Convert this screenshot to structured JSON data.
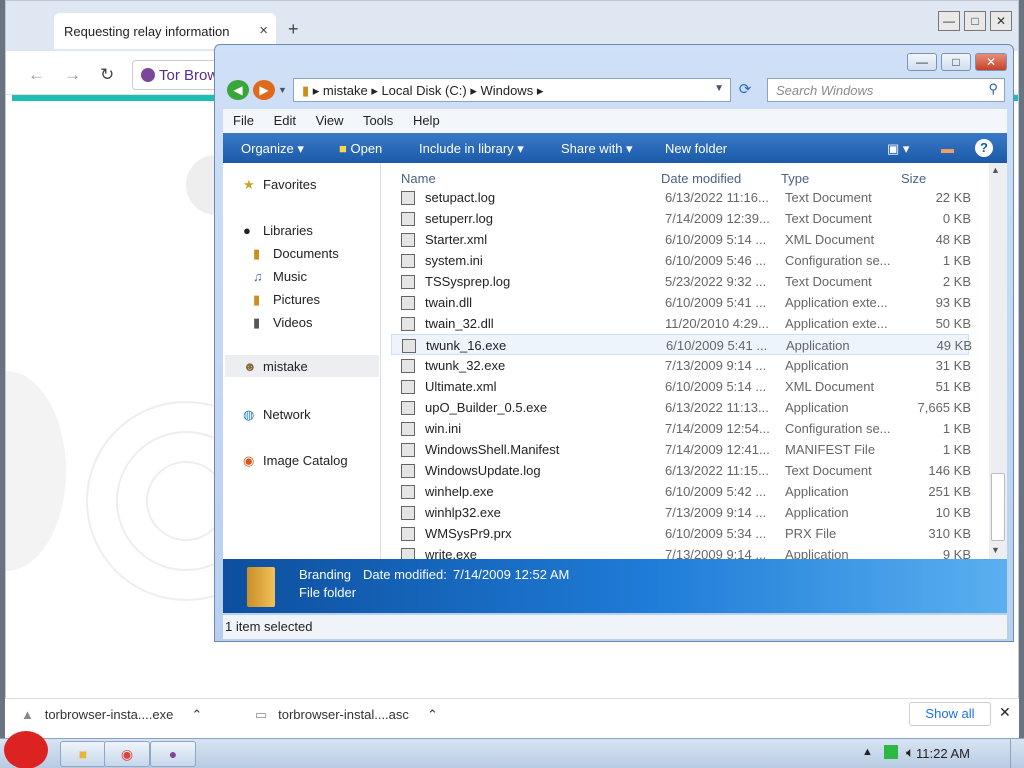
{
  "browser": {
    "tab_title": "Requesting relay information",
    "tab_close": "×",
    "new_tab": "+",
    "back": "←",
    "forward": "→",
    "reload": "↻",
    "omnibox_text": "Tor Brow",
    "win_min": "—",
    "win_max": "□",
    "win_close": "✕"
  },
  "explorer": {
    "breadcrumb": [
      "mistake",
      "Local Disk (C:)",
      "Windows"
    ],
    "search_placeholder": "Search Windows",
    "menu": [
      "File",
      "Edit",
      "View",
      "Tools",
      "Help"
    ],
    "commands": [
      "Organize",
      "Open",
      "Include in library",
      "Share with",
      "New folder"
    ],
    "nav": {
      "favorites": "Favorites",
      "libraries": "Libraries",
      "documents": "Documents",
      "music": "Music",
      "pictures": "Pictures",
      "videos": "Videos",
      "mistake": "mistake",
      "network": "Network",
      "image_catalog": "Image Catalog"
    },
    "columns": {
      "name": "Name",
      "date": "Date modified",
      "type": "Type",
      "size": "Size"
    },
    "files": [
      {
        "name": "setupact.log",
        "date": "6/13/2022 11:16...",
        "type": "Text Document",
        "size": "22 KB"
      },
      {
        "name": "setuperr.log",
        "date": "7/14/2009 12:39...",
        "type": "Text Document",
        "size": "0 KB"
      },
      {
        "name": "Starter.xml",
        "date": "6/10/2009 5:14 ...",
        "type": "XML Document",
        "size": "48 KB"
      },
      {
        "name": "system.ini",
        "date": "6/10/2009 5:46 ...",
        "type": "Configuration se...",
        "size": "1 KB"
      },
      {
        "name": "TSSysprep.log",
        "date": "5/23/2022 9:32 ...",
        "type": "Text Document",
        "size": "2 KB"
      },
      {
        "name": "twain.dll",
        "date": "6/10/2009 5:41 ...",
        "type": "Application exte...",
        "size": "93 KB"
      },
      {
        "name": "twain_32.dll",
        "date": "11/20/2010 4:29...",
        "type": "Application exte...",
        "size": "50 KB"
      },
      {
        "name": "twunk_16.exe",
        "date": "6/10/2009 5:41 ...",
        "type": "Application",
        "size": "49 KB"
      },
      {
        "name": "twunk_32.exe",
        "date": "7/13/2009 9:14 ...",
        "type": "Application",
        "size": "31 KB"
      },
      {
        "name": "Ultimate.xml",
        "date": "6/10/2009 5:14 ...",
        "type": "XML Document",
        "size": "51 KB"
      },
      {
        "name": "upO_Builder_0.5.exe",
        "date": "6/13/2022 11:13...",
        "type": "Application",
        "size": "7,665 KB"
      },
      {
        "name": "win.ini",
        "date": "7/14/2009 12:54...",
        "type": "Configuration se...",
        "size": "1 KB"
      },
      {
        "name": "WindowsShell.Manifest",
        "date": "7/14/2009 12:41...",
        "type": "MANIFEST File",
        "size": "1 KB"
      },
      {
        "name": "WindowsUpdate.log",
        "date": "6/13/2022 11:15...",
        "type": "Text Document",
        "size": "146 KB"
      },
      {
        "name": "winhelp.exe",
        "date": "6/10/2009 5:42 ...",
        "type": "Application",
        "size": "251 KB"
      },
      {
        "name": "winhlp32.exe",
        "date": "7/13/2009 9:14 ...",
        "type": "Application",
        "size": "10 KB"
      },
      {
        "name": "WMSysPr9.prx",
        "date": "6/10/2009 5:34 ...",
        "type": "PRX File",
        "size": "310 KB"
      },
      {
        "name": "write.exe",
        "date": "7/13/2009 9:14 ...",
        "type": "Application",
        "size": "9 KB"
      }
    ],
    "details": {
      "name": "Branding",
      "date_label": "Date modified:",
      "date_value": "7/14/2009 12:52 AM",
      "type": "File folder"
    },
    "status": "1 item selected"
  },
  "downloads": [
    {
      "name": "torbrowser-insta....exe"
    },
    {
      "name": "torbrowser-instal....asc"
    }
  ],
  "show_all": "Show all",
  "clock": "11:22 AM"
}
